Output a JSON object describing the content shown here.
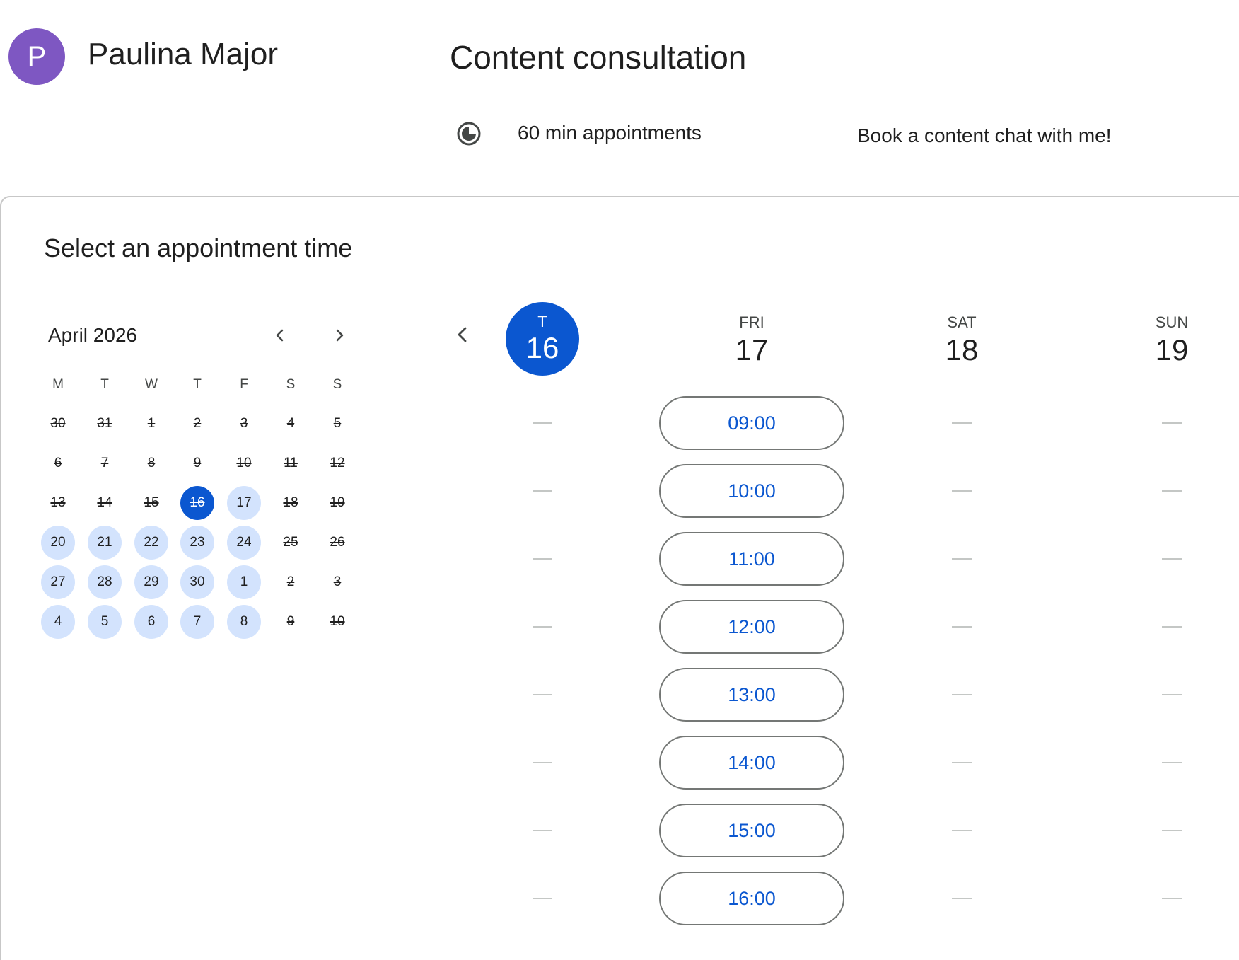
{
  "owner": {
    "avatar_initial": "P",
    "name": "Paulina Major"
  },
  "event": {
    "title": "Content consultation",
    "duration_icon": "clock-half-icon",
    "duration_label": "60 min appointments",
    "description": "Book a content chat with me!"
  },
  "section_title": "Select an appointment time",
  "mini_calendar": {
    "month_label": "April 2026",
    "prev_icon": "chevron-left-icon",
    "next_icon": "chevron-right-icon",
    "weekday_headers": [
      "M",
      "T",
      "W",
      "T",
      "F",
      "S",
      "S"
    ],
    "weeks": [
      [
        {
          "d": "30",
          "s": "unavailable"
        },
        {
          "d": "31",
          "s": "unavailable"
        },
        {
          "d": "1",
          "s": "unavailable"
        },
        {
          "d": "2",
          "s": "unavailable"
        },
        {
          "d": "3",
          "s": "unavailable"
        },
        {
          "d": "4",
          "s": "unavailable"
        },
        {
          "d": "5",
          "s": "unavailable"
        }
      ],
      [
        {
          "d": "6",
          "s": "unavailable"
        },
        {
          "d": "7",
          "s": "unavailable"
        },
        {
          "d": "8",
          "s": "unavailable"
        },
        {
          "d": "9",
          "s": "unavailable"
        },
        {
          "d": "10",
          "s": "unavailable"
        },
        {
          "d": "11",
          "s": "unavailable"
        },
        {
          "d": "12",
          "s": "unavailable"
        }
      ],
      [
        {
          "d": "13",
          "s": "unavailable"
        },
        {
          "d": "14",
          "s": "unavailable"
        },
        {
          "d": "15",
          "s": "unavailable"
        },
        {
          "d": "16",
          "s": "selected"
        },
        {
          "d": "17",
          "s": "available"
        },
        {
          "d": "18",
          "s": "unavailable"
        },
        {
          "d": "19",
          "s": "unavailable"
        }
      ],
      [
        {
          "d": "20",
          "s": "available"
        },
        {
          "d": "21",
          "s": "available"
        },
        {
          "d": "22",
          "s": "available"
        },
        {
          "d": "23",
          "s": "available"
        },
        {
          "d": "24",
          "s": "available"
        },
        {
          "d": "25",
          "s": "unavailable"
        },
        {
          "d": "26",
          "s": "unavailable"
        }
      ],
      [
        {
          "d": "27",
          "s": "available"
        },
        {
          "d": "28",
          "s": "available"
        },
        {
          "d": "29",
          "s": "available"
        },
        {
          "d": "30",
          "s": "available"
        },
        {
          "d": "1",
          "s": "available"
        },
        {
          "d": "2",
          "s": "unavailable"
        },
        {
          "d": "3",
          "s": "unavailable"
        }
      ],
      [
        {
          "d": "4",
          "s": "available"
        },
        {
          "d": "5",
          "s": "available"
        },
        {
          "d": "6",
          "s": "available"
        },
        {
          "d": "7",
          "s": "available"
        },
        {
          "d": "8",
          "s": "available"
        },
        {
          "d": "9",
          "s": "unavailable"
        },
        {
          "d": "10",
          "s": "unavailable"
        }
      ]
    ]
  },
  "week_view": {
    "prev_icon": "chevron-left-icon",
    "days": [
      {
        "dow": "T",
        "num": "16",
        "selected": true,
        "slots": []
      },
      {
        "dow": "FRI",
        "num": "17",
        "selected": false,
        "slots": [
          "09:00",
          "10:00",
          "11:00",
          "12:00",
          "13:00",
          "14:00",
          "15:00",
          "16:00"
        ]
      },
      {
        "dow": "SAT",
        "num": "18",
        "selected": false,
        "slots": []
      },
      {
        "dow": "SUN",
        "num": "19",
        "selected": false,
        "slots": []
      }
    ],
    "empty_marker_rows": 8
  },
  "colors": {
    "primary": "#0b57d0",
    "available_day_bg": "#d3e3fd",
    "avatar": "#7e57c2",
    "slot_border": "#747775",
    "divider": "#c7c7c7"
  }
}
